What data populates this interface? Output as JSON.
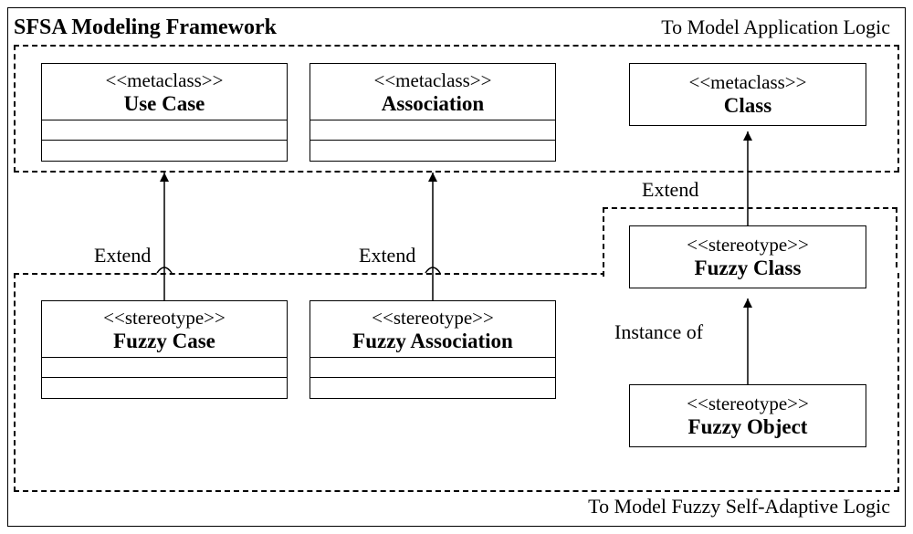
{
  "title": "SFSA Modeling Framework",
  "topLabel": "To Model Application Logic",
  "bottomLabel": "To Model Fuzzy Self-Adaptive Logic",
  "boxes": {
    "useCase": {
      "stereo": "<<metaclass>>",
      "name": "Use Case"
    },
    "association": {
      "stereo": "<<metaclass>>",
      "name": "Association"
    },
    "classBox": {
      "stereo": "<<metaclass>>",
      "name": "Class"
    },
    "fuzzyCase": {
      "stereo": "<<stereotype>>",
      "name": "Fuzzy Case"
    },
    "fuzzyAssoc": {
      "stereo": "<<stereotype>>",
      "name": "Fuzzy Association"
    },
    "fuzzyClass": {
      "stereo": "<<stereotype>>",
      "name": "Fuzzy Class"
    },
    "fuzzyObject": {
      "stereo": "<<stereotype>>",
      "name": "Fuzzy Object"
    }
  },
  "relations": {
    "extend1": "Extend",
    "extend2": "Extend",
    "extend3": "Extend",
    "instanceOf": "Instance of"
  }
}
